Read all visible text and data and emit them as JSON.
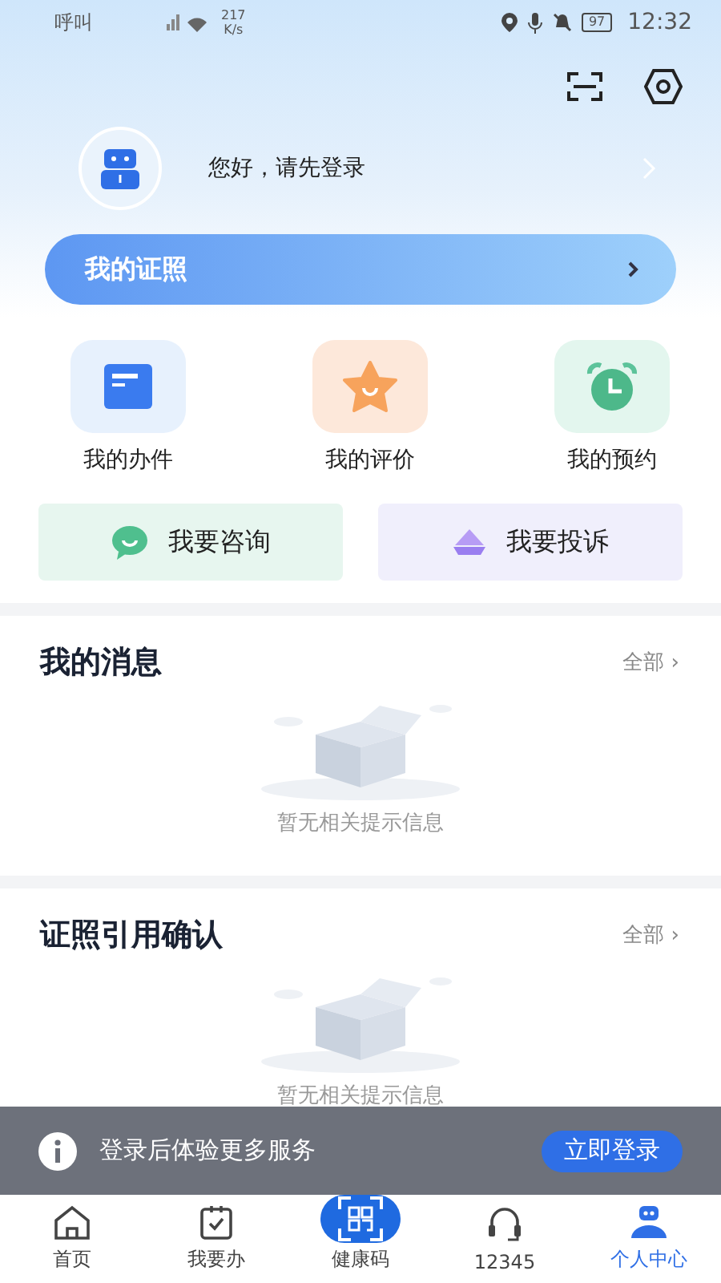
{
  "status_bar": {
    "carrier": "呼叫",
    "speed": "217\nK/s",
    "battery": "97",
    "time": "12:32"
  },
  "profile": {
    "greeting": "您好，请先登录"
  },
  "certificate_bar": {
    "label": "我的证照"
  },
  "shortcuts": [
    {
      "kind": "tasks",
      "label": "我的办件"
    },
    {
      "kind": "reviews",
      "label": "我的评价"
    },
    {
      "kind": "appointments",
      "label": "我的预约"
    }
  ],
  "actions": [
    {
      "kind": "consult",
      "label": "我要咨询"
    },
    {
      "kind": "complain",
      "label": "我要投诉"
    }
  ],
  "sections": [
    {
      "title": "我的消息",
      "more": "全部 ›",
      "empty_text": "暂无相关提示信息"
    },
    {
      "title": "证照引用确认",
      "more": "全部 ›",
      "empty_text": "暂无相关提示信息"
    }
  ],
  "login_banner": {
    "message": "登录后体验更多服务",
    "button": "立即登录"
  },
  "tab_bar": [
    {
      "kind": "home",
      "label": "首页",
      "selected": false
    },
    {
      "kind": "todo",
      "label": "我要办",
      "selected": false
    },
    {
      "kind": "qr",
      "label": "健康码",
      "selected": false
    },
    {
      "kind": "hotline",
      "label": "12345",
      "selected": false
    },
    {
      "kind": "profile",
      "label": "个人中心",
      "selected": true
    }
  ]
}
